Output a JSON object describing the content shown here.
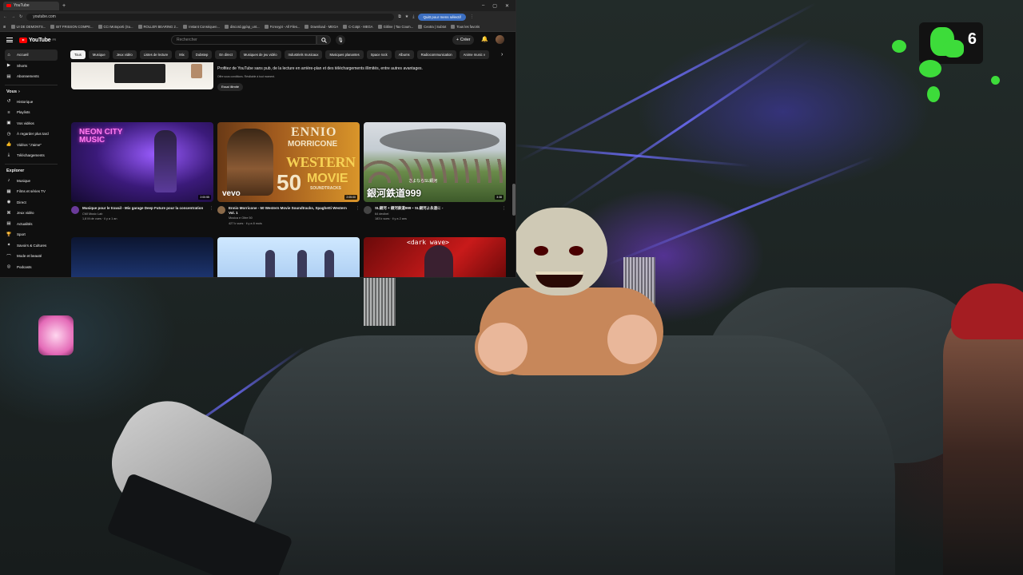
{
  "browser": {
    "tab_title": "YouTube",
    "url": "youtube.com",
    "update_button": "Quitt pour mens sélectif",
    "bookmarks": [
      "UI DE DEMONTS...",
      "BIT FRISSON COMPE...",
      "CCI Motoporti (Su...",
      "ROLLER BEARING 2...",
      "Instant Conséquen...",
      "discord.gg/ap_unt...",
      "Fcrexypt - All Files...",
      "Download - MEGA",
      "C-Cotpt - MEGA",
      "Gitline | Tax Coum...",
      "Ceotra | Subtot",
      "Tous les favoris"
    ]
  },
  "youtube": {
    "logo_text": "YouTube",
    "logo_suffix": "FR",
    "search_placeholder": "Rechercher",
    "create_label": "Créer",
    "sidebar": {
      "items": [
        "Accueil",
        "Shorts",
        "Abonnements"
      ],
      "vous_label": "Vous",
      "vous_items": [
        "Historique",
        "Playlists",
        "Vos vidéos",
        "À regarder plus tard",
        "Vidéos \"J'aime\"",
        "Téléchargements"
      ],
      "explore_label": "Explorer",
      "explore_items": [
        "Musique",
        "Films et séries TV",
        "Direct",
        "Jeux vidéo",
        "Actualités",
        "Sport",
        "Savoirs & Cultures",
        "Mode et beauté",
        "Podcasts"
      ]
    },
    "chips": [
      "Tous",
      "Musique",
      "Jeux vidéo",
      "Listes de lecture",
      "Mix",
      "Dubstep",
      "En direct",
      "Musiques de jeu vidéo",
      "Industriels musicaux",
      "Musiques planantes",
      "Space rock",
      "Albums",
      "Radiocommunication",
      "Anime music v"
    ],
    "promo": {
      "text": "Profitez de YouTube sans pub, de la lecture en arrière-plan et des téléchargements illimités, entre autres avantages.",
      "sub": "Offre sous conditions. Résiliable à tout moment.",
      "button": "Essai illimité"
    },
    "videos": [
      {
        "thumb_text": "NEON CITY MUSIC",
        "duration": "2:00:55",
        "title": "Musique pour le travail - Mix garage Deep Future pour la concentration",
        "channel": "CMI Music Lab",
        "meta": "1,8 M de vues · il y a 1 an"
      },
      {
        "thumb_text_1": "ENNIO",
        "thumb_text_2": "MORRICONE",
        "thumb_text_3": "WESTERN",
        "thumb_text_4": "50",
        "thumb_text_5": "MOVIE",
        "thumb_text_6": "SOUNDTRACKS",
        "thumb_brand": "vevo",
        "duration": "2:05:00",
        "title": "Ennio Morricone - 50 Western Movie Soundtracks, Spaghetti Western Vol. 1",
        "channel": "Musica e Oltre 50",
        "meta": "427 k vues · il y a 8 mois"
      },
      {
        "thumb_text": "銀河鉄道999",
        "thumb_text_small": "さよならSL銀河",
        "duration": "3:38",
        "title": "SL銀河 + 銀河鉄道999・SL銀河よ永遠に -",
        "channel": "64 decibel",
        "meta": "183 k vues · il y a 2 ans"
      },
      {
        "thumb_text": "<dark wave>"
      }
    ]
  },
  "overlay": {
    "counter": "6"
  }
}
